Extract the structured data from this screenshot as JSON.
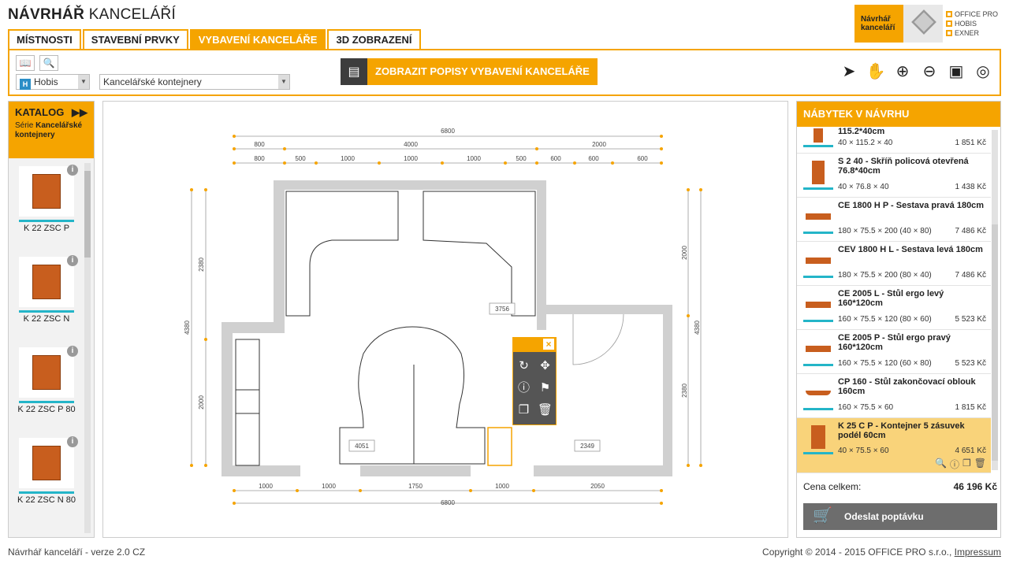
{
  "app": {
    "title_bold": "NÁVRHÁŘ",
    "title_light": " KANCELÁŘÍ",
    "brand_line1": "Návrhář",
    "brand_line2": "kanceláří",
    "brand_items": [
      "OFFICE PRO",
      "HOBIS",
      "EXNER"
    ]
  },
  "tabs": [
    {
      "label": "MÍSTNOSTI"
    },
    {
      "label": "STAVEBNÍ PRVKY"
    },
    {
      "label": "VYBAVENÍ KANCELÁŘE"
    },
    {
      "label": "3D ZOBRAZENÍ"
    }
  ],
  "toolbar": {
    "manufacturer": "Hobis",
    "category": "Kancelářské kontejnery",
    "describe_button": "ZOBRAZIT POPISY VYBAVENÍ KANCELÁŘE"
  },
  "catalog": {
    "title": "KATALOG",
    "series_label": "Série",
    "series_name": "Kancelářské kontejnery",
    "items": [
      {
        "name": "K 22 ZSC P"
      },
      {
        "name": "K 22 ZSC N"
      },
      {
        "name": "K 22 ZSC P 80"
      },
      {
        "name": "K 22 ZSC N 80"
      }
    ]
  },
  "plan": {
    "top_total": "6800",
    "top_row1": [
      "800",
      "4000",
      "2000"
    ],
    "top_row2": [
      "800",
      "500",
      "1000",
      "1000",
      "1000",
      "500",
      "600",
      "600",
      "600"
    ],
    "bottom_row": [
      "1000",
      "1000",
      "1750",
      "1000",
      "2050"
    ],
    "bottom_total": "6800",
    "left_outer": "4380",
    "left_upper": "2380",
    "left_lower": "2000",
    "right_outer": "4380",
    "right_upper": "2000",
    "right_lower": "2380",
    "inner_label1": "3756",
    "inner_label2": "4051",
    "inner_label3": "2349"
  },
  "furniture": {
    "title": "NÁBYTEK V NÁVRHU",
    "items": [
      {
        "name": "115.2*40cm",
        "dims": "40 × 115.2 × 40",
        "price": "1 851 Kč"
      },
      {
        "name": "S 2 40 - Skříň policová otevřená 76.8*40cm",
        "dims": "40 × 76.8 × 40",
        "price": "1 438 Kč"
      },
      {
        "name": "CE 1800 H P - Sestava pravá 180cm",
        "dims": "180 × 75.5 × 200 (40 × 80)",
        "price": "7 486 Kč"
      },
      {
        "name": "CEV 1800 H L - Sestava levá 180cm",
        "dims": "180 × 75.5 × 200 (80 × 40)",
        "price": "7 486 Kč"
      },
      {
        "name": "CE 2005 L - Stůl ergo levý 160*120cm",
        "dims": "160 × 75.5 × 120 (80 × 60)",
        "price": "5 523 Kč"
      },
      {
        "name": "CE 2005 P - Stůl ergo pravý 160*120cm",
        "dims": "160 × 75.5 × 120 (60 × 80)",
        "price": "5 523 Kč"
      },
      {
        "name": "CP 160 - Stůl zakončovací oblouk 160cm",
        "dims": "160 × 75.5 × 60",
        "price": "1 815 Kč"
      },
      {
        "name": "K 25 C P - Kontejner 5 zásuvek podél 60cm",
        "dims": "40 × 75.5 × 60",
        "price": "4 651 Kč"
      }
    ],
    "total_label": "Cena celkem:",
    "total_value": "46 196 Kč",
    "send_label": "Odeslat poptávku"
  },
  "footer": {
    "version": "Návrhář kanceláří - verze 2.0 CZ",
    "copyright": "Copyright © 2014 - 2015 OFFICE PRO s.r.o.,",
    "impressum": "Impressum"
  },
  "colors": {
    "accent": "#f5a400",
    "teal": "#24b5c8",
    "dark": "#3d3d3d"
  }
}
